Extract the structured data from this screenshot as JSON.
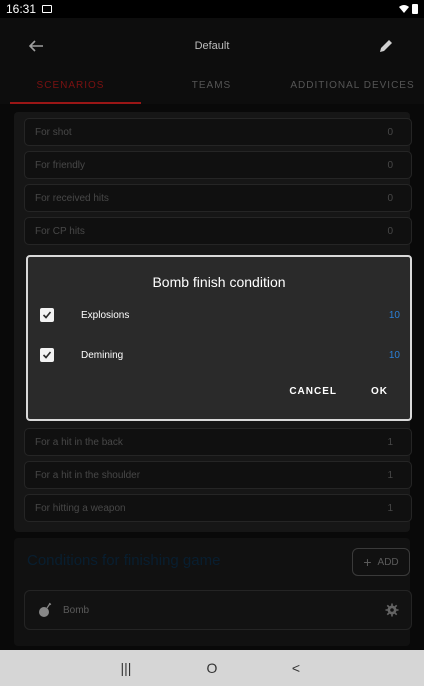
{
  "status_bar": {
    "time": "16:31"
  },
  "app_bar": {
    "title": "Default",
    "back_icon": "arrow-left-icon",
    "edit_icon": "pencil-icon"
  },
  "tabs": [
    {
      "label": "SCENARIOS",
      "active": true
    },
    {
      "label": "TEAMS",
      "active": false
    },
    {
      "label": "ADDITIONAL DEVICES",
      "active": false
    }
  ],
  "settings_rows": [
    {
      "label": "For shot",
      "value": "0"
    },
    {
      "label": "For friendly",
      "value": "0"
    },
    {
      "label": "For received hits",
      "value": "0"
    },
    {
      "label": "For CP hits",
      "value": "0"
    },
    {
      "label": "For a hit in the back",
      "value": "1"
    },
    {
      "label": "For a hit in the shoulder",
      "value": "1"
    },
    {
      "label": "For hitting a weapon",
      "value": "1"
    }
  ],
  "conditions": {
    "title": "Conditions for finishing game",
    "add_label": "ADD",
    "items": [
      {
        "label": "Bomb",
        "icon": "bomb-icon"
      }
    ]
  },
  "dialog": {
    "title": "Bomb finish condition",
    "options": [
      {
        "label": "Explosions",
        "checked": true,
        "value": "10"
      },
      {
        "label": "Demining",
        "checked": true,
        "value": "10"
      }
    ],
    "cancel_label": "CANCEL",
    "ok_label": "OK"
  },
  "nav_bar": {
    "recents": "|||",
    "home": "O",
    "back": "<"
  },
  "colors": {
    "accent_blue": "#2b7fd6",
    "tab_active": "#9a1616",
    "dialog_bg": "#2a2a2a"
  }
}
